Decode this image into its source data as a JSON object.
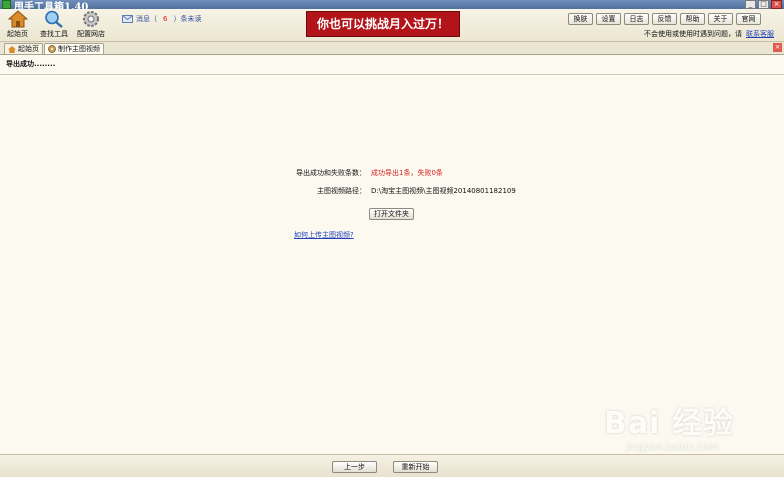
{
  "window": {
    "title": "甩手工具箱1.40",
    "controls": [
      "_",
      "□",
      "×"
    ]
  },
  "toolbar": {
    "items": [
      {
        "label": "起始页",
        "icon": "house-icon"
      },
      {
        "label": "查找工具",
        "icon": "magnifier-icon"
      },
      {
        "label": "配置网店",
        "icon": "gear-icon"
      }
    ],
    "notice_prefix": "消息（",
    "notice_count": "6",
    "notice_suffix": "）条未读",
    "banner": "你也可以挑战月入过万！",
    "buttons": [
      "换肤",
      "设置",
      "日志",
      "反馈",
      "帮助",
      "关于",
      "官网"
    ],
    "help_text": "不会使用或使用时遇到问题，请",
    "help_link": "联系客服"
  },
  "tabs": [
    {
      "label": "起始页",
      "icon": "house-icon",
      "active": false
    },
    {
      "label": "制作主图视频",
      "icon": "film-icon",
      "active": true
    }
  ],
  "content": {
    "status": "导出成功........",
    "result_label": "导出成功和失败条数：",
    "result_value": "成功导出1条，失败0条",
    "path_label": "主图视频路径：",
    "path_value": "D:\\淘宝主图视频\\主图视频20140801182109",
    "open_folder_button": "打开文件夹",
    "upload_help_link": "如何上传主图视频?"
  },
  "footer": {
    "prev_button": "上一步",
    "restart_button": "重新开始"
  },
  "watermark": {
    "text": "Bai 经验",
    "sub": "jingyan.baidu.com"
  },
  "colors": {
    "accent_red": "#b2141a",
    "link_blue": "#2240b8",
    "background": "#fbf9f0"
  }
}
